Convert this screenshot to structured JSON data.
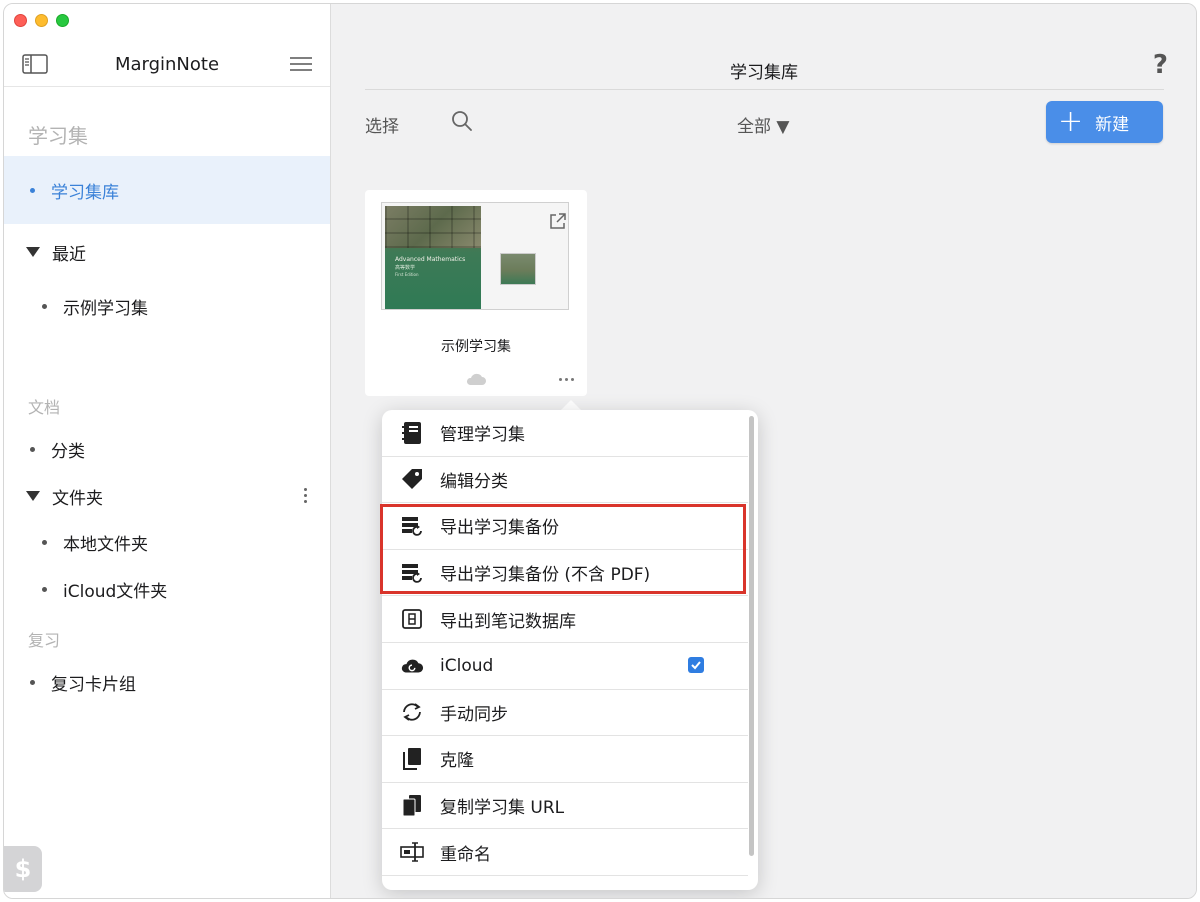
{
  "sidebar": {
    "app_title": "MarginNote",
    "section_study": "学习集",
    "item_library": "学习集库",
    "recent_label": "最近",
    "recent_items": [
      "示例学习集"
    ],
    "section_docs": "文档",
    "item_categories": "分类",
    "item_folders": "文件夹",
    "folder_items": [
      "本地文件夹",
      "iCloud文件夹"
    ],
    "section_review": "复习",
    "item_review_decks": "复习卡片组",
    "dollar_button": "$"
  },
  "main": {
    "title": "学习集库",
    "help": "?",
    "select_label": "选择",
    "filter_label": "全部 ▼",
    "new_button": {
      "plus": "+",
      "label": "新建"
    }
  },
  "card": {
    "title": "示例学习集",
    "book_title": "Advanced Mathematics",
    "book_subtitle": "高等数学",
    "book_edition": "First Edition"
  },
  "menu": {
    "items": [
      {
        "label": "管理学习集",
        "icon": "notebook-icon"
      },
      {
        "label": "编辑分类",
        "icon": "tag-icon"
      },
      {
        "label": "导出学习集备份",
        "icon": "export-backup-icon"
      },
      {
        "label": "导出学习集备份 (不含 PDF)",
        "icon": "export-backup-icon"
      },
      {
        "label": "导出到笔记数据库",
        "icon": "database-icon"
      },
      {
        "label": "iCloud",
        "icon": "icloud-icon",
        "checked": true
      },
      {
        "label": "手动同步",
        "icon": "sync-icon"
      },
      {
        "label": "克隆",
        "icon": "clone-icon"
      },
      {
        "label": "复制学习集 URL",
        "icon": "copy-icon"
      },
      {
        "label": "重命名",
        "icon": "rename-icon"
      }
    ]
  },
  "colors": {
    "accent": "#4a8ee8",
    "highlight_border": "#d9342b",
    "sidebar_active_bg": "#e9f1fb"
  }
}
